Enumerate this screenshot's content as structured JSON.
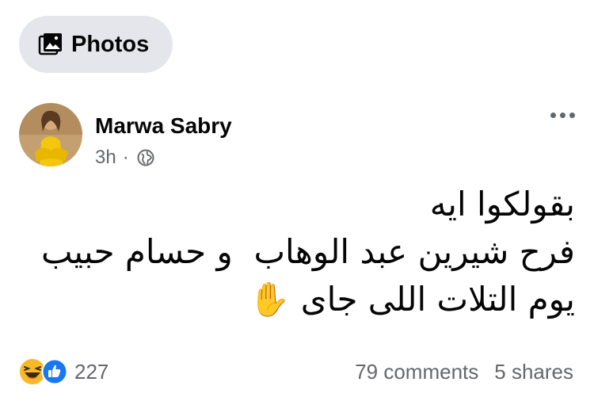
{
  "photos_tab": {
    "label": "Photos",
    "icon": "photos-icon"
  },
  "post": {
    "author": "Marwa Sabry",
    "time": "3h",
    "separator": "·",
    "audience_icon": "globe-icon",
    "lines": [
      "بقولكوا ايه",
      "فرح شيرين عبد الوهاب  و حسام حبيب",
      "يوم التلات اللى جاى ✋"
    ],
    "reactions": {
      "icons": [
        "laughing-emoji-icon",
        "like-icon"
      ],
      "count": "227"
    },
    "comments": "79 comments",
    "shares": "5 shares"
  },
  "colors": {
    "pill_bg": "#e4e6eb",
    "meta_gray": "#65676b",
    "like_blue": "#1877f2"
  }
}
